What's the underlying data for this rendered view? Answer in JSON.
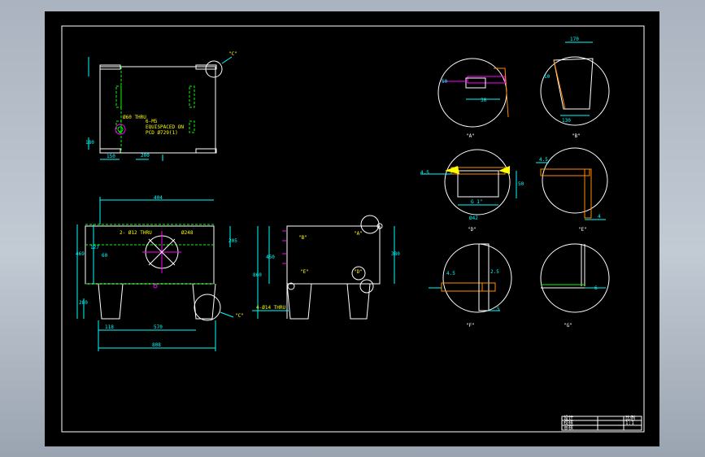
{
  "colors": {
    "outline": "#ffffff",
    "dimension": "#00ffff",
    "hidden": "#00ff00",
    "annotation": "#ffff00",
    "section": "#ff00ff",
    "hatch": "#ff8c00"
  },
  "top_view": {
    "detail_flag": "\"C\"",
    "note_hole": "Ø60 THRU",
    "note_bolts_1": "6-M5",
    "note_bolts_2": "EQUISPACED ON",
    "note_bolts_3": "PCD Ø729(1)",
    "dim_side": "180",
    "dim_left": "150",
    "dim_mid": "200"
  },
  "front_view": {
    "dim_top": "404",
    "note_thread": "2- Ø12 THRU",
    "note_bore": "Ø248",
    "dim_left_a": "127",
    "dim_left_b": "469",
    "dim_left_c": "60",
    "dim_right": "205",
    "dim_leg": "280",
    "dim_bottom_a": "118",
    "dim_bottom_b": "570",
    "dim_total": "808",
    "detail_flag": "\"C\""
  },
  "side_view": {
    "flag_b": "\"B\"",
    "flag_a": "\"A\"",
    "flag_e": "\"E\"",
    "flag_d": "\"D\"",
    "dim_left_a": "860",
    "dim_left_b": "450",
    "dim_right": "380",
    "note_bottom": "4-Ø14 THRU"
  },
  "details": {
    "a_dim_1": "50",
    "a_dim_2": "30",
    "a_label": "\"A\"",
    "b_dim_top": "170",
    "b_dim_bottom": "130",
    "b_dim_side": "10",
    "b_label": "\"B\"",
    "d_dim_1": "4.5",
    "d_dim_2": "G 1\"",
    "d_dim_3": "Ø42",
    "d_dim_4": "50",
    "d_label": "\"D\"",
    "e_dim_1": "4.5",
    "e_dim_2": "4",
    "e_label": "\"E\"",
    "f_dim_1": "4.5",
    "f_dim_2": "2.5",
    "f_dim_3": "5",
    "f_label": "\"F\"",
    "g_dim_1": "6",
    "g_label": "\"G\""
  },
  "title_block": {
    "cell_1": "设计",
    "cell_2": "校核",
    "cell_3": "审核",
    "cell_4": "比例",
    "cell_5": "1:1"
  }
}
